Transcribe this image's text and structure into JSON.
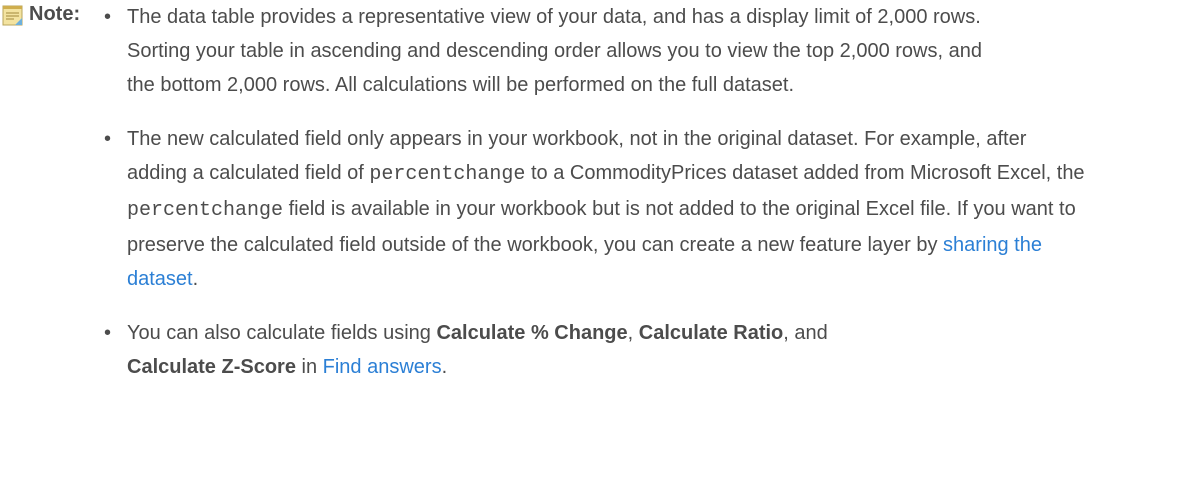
{
  "note": {
    "label": "Note:",
    "icon": "note-icon",
    "bullet_glyph": "•",
    "colors": {
      "text": "#4c4c4c",
      "link": "#2b7fd5",
      "icon_fill": "#f3e3a0",
      "icon_fold": "#6db0dc"
    }
  },
  "items": [
    {
      "text": "The data table provides a representative view of your data, and has a display limit of 2,000 rows. Sorting your table in ascending and descending order allows you to view the top 2,000 rows, and the bottom 2,000 rows. All calculations will be performed on the full dataset."
    },
    {
      "t1": "The new calculated field only appears in your workbook, not in the original dataset. For example, after adding a calculated field of ",
      "code1": "percentchange",
      "t2": " to a CommodityPrices dataset added from Microsoft Excel, the ",
      "code2": "percentchange",
      "t3": " field is available in your workbook but is not added to the original Excel file. If you want to preserve the calculated field outside of the workbook, you can create a new feature layer by ",
      "link": "sharing the dataset",
      "t4": "."
    },
    {
      "t1": "You can also calculate fields using ",
      "b1": "Calculate % Change",
      "t2": ", ",
      "b2": "Calculate Ratio",
      "t3": ", and ",
      "b3": "Calculate Z-Score",
      "t4": " in ",
      "link": "Find answers",
      "t5": "."
    }
  ]
}
